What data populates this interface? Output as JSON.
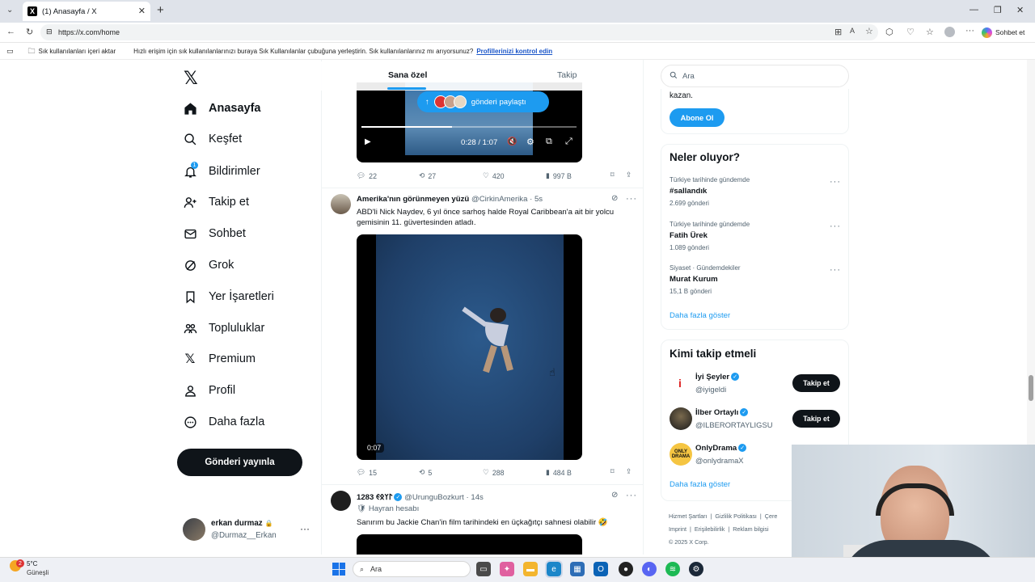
{
  "browser": {
    "tab_title": "(1) Anasayfa / X",
    "url": "https://x.com/home",
    "copilot_label": "Sohbet et",
    "favbar_import": "Sık kullanılanları içeri aktar",
    "favbar_hint": "Hızlı erişim için sık kullanılanlarınızı buraya Sık Kullanılanlar çubuğuna yerleştirin. Sık kullanılanlarınız mı arıyorsunuz?",
    "favbar_link": "Profillerinizi kontrol edin"
  },
  "sidebar": {
    "items": [
      {
        "label": "Anasayfa",
        "icon": "home-icon"
      },
      {
        "label": "Keşfet",
        "icon": "search-icon"
      },
      {
        "label": "Bildirimler",
        "icon": "bell-icon"
      },
      {
        "label": "Takip et",
        "icon": "add-user-icon"
      },
      {
        "label": "Sohbet",
        "icon": "mail-icon"
      },
      {
        "label": "Grok",
        "icon": "grok-icon"
      },
      {
        "label": "Yer İşaretleri",
        "icon": "bookmark-icon"
      },
      {
        "label": "Topluluklar",
        "icon": "communities-icon"
      },
      {
        "label": "Premium",
        "icon": "x-icon"
      },
      {
        "label": "Profil",
        "icon": "profile-icon"
      },
      {
        "label": "Daha fazla",
        "icon": "more-icon"
      }
    ],
    "notification_count": "1",
    "post_button": "Gönderi yayınla",
    "account": {
      "name": "erkan durmaz",
      "handle": "@Durmaz__Erkan"
    }
  },
  "feed": {
    "tabs": [
      "Sana özel",
      "Takip"
    ],
    "posts": [
      {
        "video_time": "0:28 / 1:07",
        "repost_pill": "gönderi paylaştı",
        "stats": {
          "replies": "22",
          "reposts": "27",
          "likes": "420",
          "views": "997 B"
        }
      },
      {
        "author": "Amerika'nın görünmeyen yüzü",
        "handle": "@CirkinAmerika",
        "time": "· 5s",
        "text": "ABD'li Nick Naydev, 6 yıl önce sarhoş halde Royal Caribbean'a ait bir yolcu gemisinin 11. güvertesinden atladı.",
        "video_duration": "0:07",
        "stats": {
          "replies": "15",
          "reposts": "5",
          "likes": "288",
          "views": "484 B"
        }
      },
      {
        "author": "1283 𐰃𐰠𐰋𐰏",
        "handle": "@UrunguBozkurt",
        "time": "· 14s",
        "badge": "Hayran hesabı",
        "text": "Sanırım bu Jackie Chan'in film tarihindeki en üçkağıtçı sahnesi olabilir 🤣"
      }
    ]
  },
  "right": {
    "search_placeholder": "Ara",
    "premium_text": "kazan.",
    "subscribe_button": "Abone Ol",
    "trends_title": "Neler oluyor?",
    "trends": [
      {
        "context": "Türkiye tarihinde gündemde",
        "name": "#sallandık",
        "posts": "2.699 gönderi"
      },
      {
        "context": "Türkiye tarihinde gündemde",
        "name": "Fatih Ürek",
        "posts": "1.089 gönderi"
      },
      {
        "context": "Siyaset · Gündemdekiler",
        "name": "Murat Kurum",
        "posts": "15,1 B gönderi"
      }
    ],
    "show_more": "Daha fazla göster",
    "who_title": "Kimi takip etmeli",
    "who": [
      {
        "name": "İyi Şeyler",
        "handle": "@iyigeldi",
        "button": "Takip et"
      },
      {
        "name": "İlber Ortaylı",
        "handle": "@ILBERORTAYLIGSU",
        "button": "Takip et"
      },
      {
        "name": "OnlyDrama",
        "handle": "@onlydramaX",
        "button": ""
      }
    ],
    "who_more": "Daha fazla göster",
    "footer": [
      "Hizmet Şartları",
      "Gizlilik Politikası",
      "Çere",
      "Imprint",
      "Erişilebilirlik",
      "Reklam bilgisi"
    ],
    "copyright": "© 2025 X Corp."
  },
  "taskbar": {
    "weather_temp": "5°C",
    "weather_desc": "Güneşli",
    "weather_badge": "2",
    "search_label": "Ara"
  },
  "colors": {
    "accent": "#1d9bf0",
    "text": "#0f1419",
    "muted": "#536471"
  }
}
